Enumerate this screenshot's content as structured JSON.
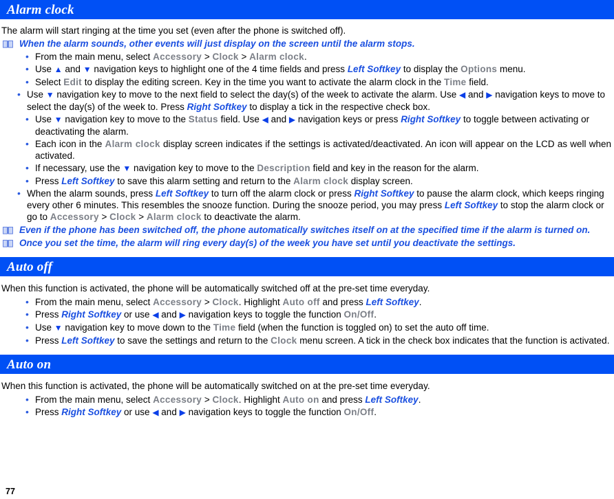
{
  "page": {
    "number": "77",
    "accent_blue": "#0050F5",
    "link_blue": "#1A4FE0",
    "ui_gray": "#7B7F87"
  },
  "icons": {
    "note": "open-book-icon",
    "up": "▲",
    "down": "▼",
    "left": "◀",
    "right": "▶"
  },
  "sections": [
    {
      "title": "Alarm clock",
      "intro": "The alarm will start ringing at the time you set (even after the phone is switched off).",
      "top_note": "When the alarm sounds, other events will just display on the screen until the alarm stops.",
      "bullets": {
        "b1_a": "From the main menu, select ",
        "b1_accessory": "Accessory",
        "b1_gt1": " > ",
        "b1_clock": "Clock",
        "b1_gt2": " > ",
        "b1_alarmclock": "Alarm clock",
        "b1_end": ".",
        "b2_a": "Use ",
        "b2_b": " and ",
        "b2_c": " navigation keys to highlight one of the 4 time fields and press ",
        "b2_softkey": "Left Softkey",
        "b2_d": "  to display the ",
        "b2_options": "Options",
        "b2_e": " menu.",
        "b3_a": "Select ",
        "b3_edit": "Edit",
        "b3_b": " to display the editing screen. Key in the time you want to activate the alarm clock in the ",
        "b3_time": "Time",
        "b3_c": " field.",
        "b4_a": "Use ",
        "b4_b": " navigation key to move to the next field to select the day(s) of the week to activate the alarm. Use ",
        "b4_c": " and ",
        "b4_d": " navigation keys to move to select  the day(s) of the week to. Press ",
        "b4_softkey": "Right Softkey",
        "b4_e": " to display a tick in the respective check box.",
        "b5_a": "Use ",
        "b5_b": " navigation key to move to the ",
        "b5_status": "Status",
        "b5_c": " field. Use ",
        "b5_d": " and ",
        "b5_e": " navigation keys or press ",
        "b5_softkey": "Right Softkey",
        "b5_f": " to toggle between activating or deactivating the alarm.",
        "b6_a": "Each icon in the ",
        "b6_alarmclock": "Alarm clock",
        "b6_b": " display screen indicates if the settings is activated/deactivated. An icon will appear on the LCD as well when activated.",
        "b7_a": "If necessary, use the ",
        "b7_b": " navigation key to move to the ",
        "b7_desc": "Description",
        "b7_c": " field and key in the reason for the alarm.",
        "b8_a": "Press ",
        "b8_softkey": "Left Softkey",
        "b8_b": " to save this alarm setting and return to the ",
        "b8_alarmclock": "Alarm clock",
        "b8_c": " display screen.",
        "b9_a": "When the alarm sounds, press ",
        "b9_softkey1": "Left Softkey",
        "b9_b": " to turn off the alarm clock or press ",
        "b9_softkey2": "Right Softkey",
        "b9_c": " to pause the alarm clock, which keeps ringing every other 6 minutes. This resembles the snooze function. During the snooze period, you may press ",
        "b9_softkey3": "Left Softkey",
        "b9_d": " to stop the alarm clock or go to ",
        "b9_accessory": "Accessory",
        "b9_gt1": " > ",
        "b9_clock": "Clock",
        "b9_gt2": " > ",
        "b9_alarmclock": "Alarm clock",
        "b9_e": " to deactivate the alarm."
      },
      "bottom_notes": [
        "Even if the phone has been switched off, the phone automatically switches itself on at the specified time if the alarm is turned on.",
        "Once you set the time, the alarm will ring every day(s) of the week you have set until you deactivate the settings."
      ]
    },
    {
      "title": "Auto off",
      "intro": "When this function is activated, the phone will be automatically switched off at the pre-set time everyday.",
      "bullets": {
        "b1_a": "From the main menu, select ",
        "b1_accessory": "Accessory",
        "b1_gt": " > ",
        "b1_clock": "Clock",
        "b1_b": ". Highlight ",
        "b1_autooff": "Auto off",
        "b1_c": " and press ",
        "b1_softkey": "Left Softkey",
        "b1_d": ".",
        "b2_a": "Press ",
        "b2_softkey": "Right Softkey",
        "b2_b": " or use ",
        "b2_c": " and ",
        "b2_d": " navigation keys to toggle the function ",
        "b2_onoff": "On/Off",
        "b2_e": ".",
        "b3_a": "Use ",
        "b3_b": " navigation key to move down to the ",
        "b3_time": "Time",
        "b3_c": " field (when the function is toggled on) to set the auto off time.",
        "b4_a": "Press ",
        "b4_softkey": "Left Softkey",
        "b4_b": " to save the settings and return to the ",
        "b4_clock": "Clock",
        "b4_c": " menu screen. A tick in the check box indicates that the function is activated."
      }
    },
    {
      "title": "Auto on",
      "intro": "When this function is activated, the phone will be automatically switched on at the pre-set time everyday.",
      "bullets": {
        "b1_a": "From the main menu, select ",
        "b1_accessory": "Accessory",
        "b1_gt": " > ",
        "b1_clock": "Clock",
        "b1_b": ". Highlight ",
        "b1_autoon": "Auto on",
        "b1_c": " and press ",
        "b1_softkey": "Left Softkey",
        "b1_d": ".",
        "b2_a": "Press ",
        "b2_softkey": "Right Softkey",
        "b2_b": " or use ",
        "b2_c": " and ",
        "b2_d": " navigation keys to toggle the function ",
        "b2_onoff": "On/Off",
        "b2_e": "."
      }
    }
  ]
}
